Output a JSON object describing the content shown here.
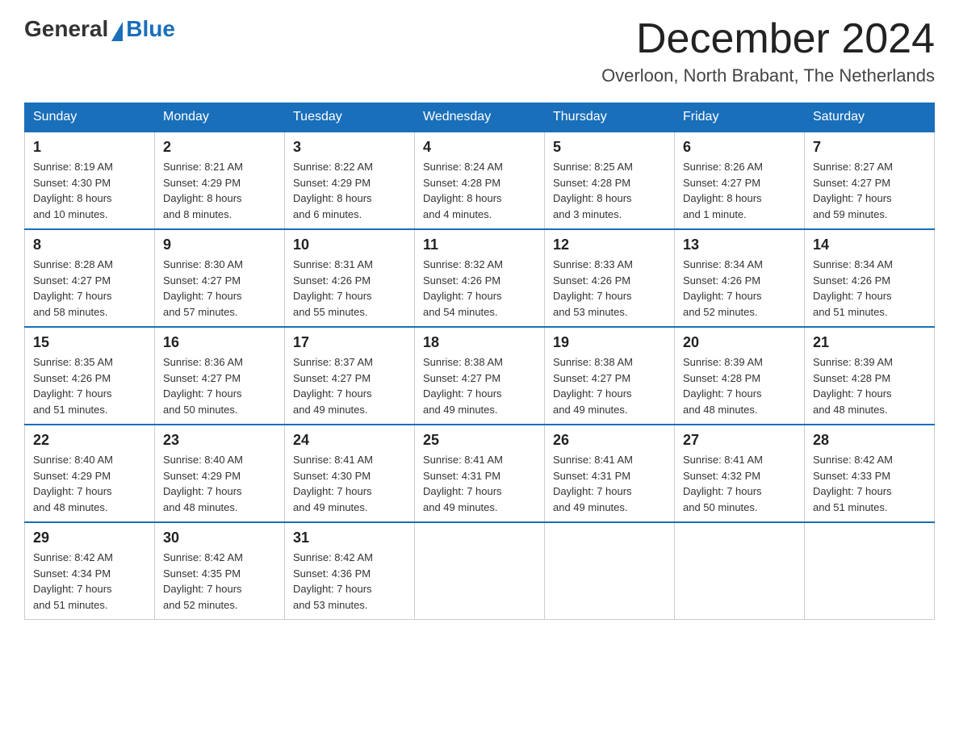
{
  "header": {
    "logo_general": "General",
    "logo_blue": "Blue",
    "month_title": "December 2024",
    "subtitle": "Overloon, North Brabant, The Netherlands"
  },
  "days_of_week": [
    "Sunday",
    "Monday",
    "Tuesday",
    "Wednesday",
    "Thursday",
    "Friday",
    "Saturday"
  ],
  "weeks": [
    [
      {
        "day": "1",
        "info": "Sunrise: 8:19 AM\nSunset: 4:30 PM\nDaylight: 8 hours\nand 10 minutes."
      },
      {
        "day": "2",
        "info": "Sunrise: 8:21 AM\nSunset: 4:29 PM\nDaylight: 8 hours\nand 8 minutes."
      },
      {
        "day": "3",
        "info": "Sunrise: 8:22 AM\nSunset: 4:29 PM\nDaylight: 8 hours\nand 6 minutes."
      },
      {
        "day": "4",
        "info": "Sunrise: 8:24 AM\nSunset: 4:28 PM\nDaylight: 8 hours\nand 4 minutes."
      },
      {
        "day": "5",
        "info": "Sunrise: 8:25 AM\nSunset: 4:28 PM\nDaylight: 8 hours\nand 3 minutes."
      },
      {
        "day": "6",
        "info": "Sunrise: 8:26 AM\nSunset: 4:27 PM\nDaylight: 8 hours\nand 1 minute."
      },
      {
        "day": "7",
        "info": "Sunrise: 8:27 AM\nSunset: 4:27 PM\nDaylight: 7 hours\nand 59 minutes."
      }
    ],
    [
      {
        "day": "8",
        "info": "Sunrise: 8:28 AM\nSunset: 4:27 PM\nDaylight: 7 hours\nand 58 minutes."
      },
      {
        "day": "9",
        "info": "Sunrise: 8:30 AM\nSunset: 4:27 PM\nDaylight: 7 hours\nand 57 minutes."
      },
      {
        "day": "10",
        "info": "Sunrise: 8:31 AM\nSunset: 4:26 PM\nDaylight: 7 hours\nand 55 minutes."
      },
      {
        "day": "11",
        "info": "Sunrise: 8:32 AM\nSunset: 4:26 PM\nDaylight: 7 hours\nand 54 minutes."
      },
      {
        "day": "12",
        "info": "Sunrise: 8:33 AM\nSunset: 4:26 PM\nDaylight: 7 hours\nand 53 minutes."
      },
      {
        "day": "13",
        "info": "Sunrise: 8:34 AM\nSunset: 4:26 PM\nDaylight: 7 hours\nand 52 minutes."
      },
      {
        "day": "14",
        "info": "Sunrise: 8:34 AM\nSunset: 4:26 PM\nDaylight: 7 hours\nand 51 minutes."
      }
    ],
    [
      {
        "day": "15",
        "info": "Sunrise: 8:35 AM\nSunset: 4:26 PM\nDaylight: 7 hours\nand 51 minutes."
      },
      {
        "day": "16",
        "info": "Sunrise: 8:36 AM\nSunset: 4:27 PM\nDaylight: 7 hours\nand 50 minutes."
      },
      {
        "day": "17",
        "info": "Sunrise: 8:37 AM\nSunset: 4:27 PM\nDaylight: 7 hours\nand 49 minutes."
      },
      {
        "day": "18",
        "info": "Sunrise: 8:38 AM\nSunset: 4:27 PM\nDaylight: 7 hours\nand 49 minutes."
      },
      {
        "day": "19",
        "info": "Sunrise: 8:38 AM\nSunset: 4:27 PM\nDaylight: 7 hours\nand 49 minutes."
      },
      {
        "day": "20",
        "info": "Sunrise: 8:39 AM\nSunset: 4:28 PM\nDaylight: 7 hours\nand 48 minutes."
      },
      {
        "day": "21",
        "info": "Sunrise: 8:39 AM\nSunset: 4:28 PM\nDaylight: 7 hours\nand 48 minutes."
      }
    ],
    [
      {
        "day": "22",
        "info": "Sunrise: 8:40 AM\nSunset: 4:29 PM\nDaylight: 7 hours\nand 48 minutes."
      },
      {
        "day": "23",
        "info": "Sunrise: 8:40 AM\nSunset: 4:29 PM\nDaylight: 7 hours\nand 48 minutes."
      },
      {
        "day": "24",
        "info": "Sunrise: 8:41 AM\nSunset: 4:30 PM\nDaylight: 7 hours\nand 49 minutes."
      },
      {
        "day": "25",
        "info": "Sunrise: 8:41 AM\nSunset: 4:31 PM\nDaylight: 7 hours\nand 49 minutes."
      },
      {
        "day": "26",
        "info": "Sunrise: 8:41 AM\nSunset: 4:31 PM\nDaylight: 7 hours\nand 49 minutes."
      },
      {
        "day": "27",
        "info": "Sunrise: 8:41 AM\nSunset: 4:32 PM\nDaylight: 7 hours\nand 50 minutes."
      },
      {
        "day": "28",
        "info": "Sunrise: 8:42 AM\nSunset: 4:33 PM\nDaylight: 7 hours\nand 51 minutes."
      }
    ],
    [
      {
        "day": "29",
        "info": "Sunrise: 8:42 AM\nSunset: 4:34 PM\nDaylight: 7 hours\nand 51 minutes."
      },
      {
        "day": "30",
        "info": "Sunrise: 8:42 AM\nSunset: 4:35 PM\nDaylight: 7 hours\nand 52 minutes."
      },
      {
        "day": "31",
        "info": "Sunrise: 8:42 AM\nSunset: 4:36 PM\nDaylight: 7 hours\nand 53 minutes."
      },
      {
        "day": "",
        "info": ""
      },
      {
        "day": "",
        "info": ""
      },
      {
        "day": "",
        "info": ""
      },
      {
        "day": "",
        "info": ""
      }
    ]
  ]
}
